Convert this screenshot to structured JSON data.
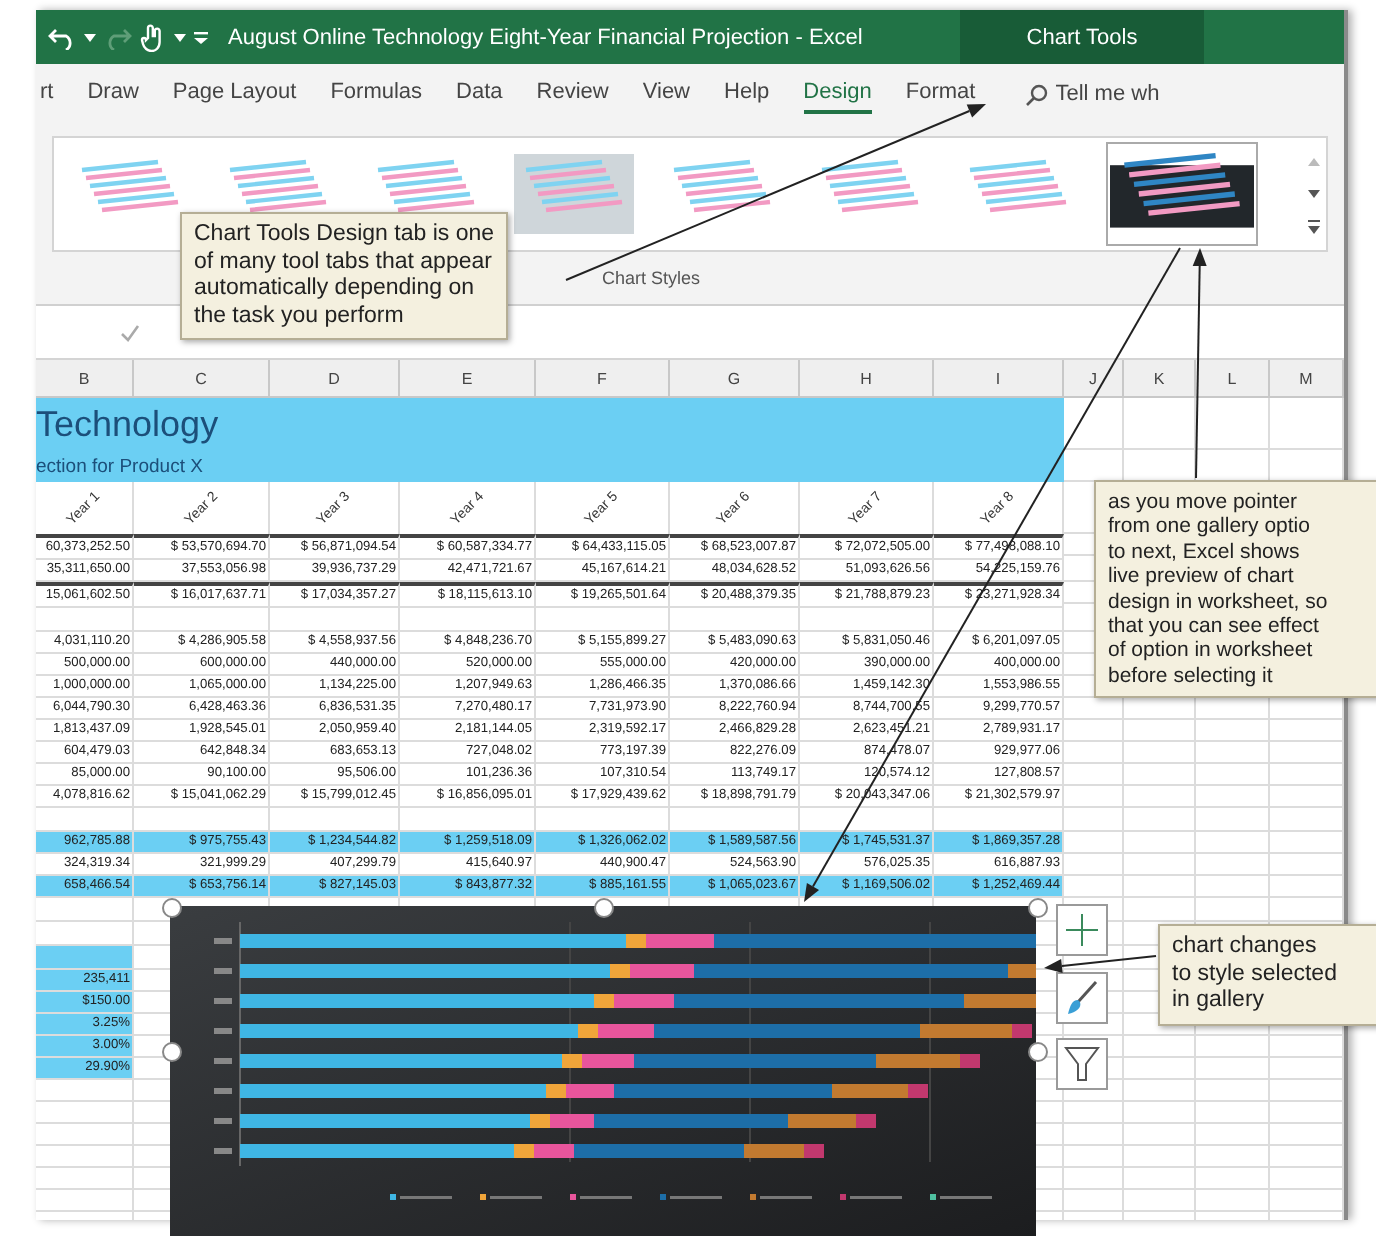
{
  "title_bar": {
    "title": "August Online Technology Eight-Year Financial Projection  -  Excel",
    "context_tab": "Chart Tools"
  },
  "ribbon": {
    "tabs": [
      {
        "label": "rt",
        "selected": false
      },
      {
        "label": "Draw",
        "selected": false
      },
      {
        "label": "Page Layout",
        "selected": false
      },
      {
        "label": "Formulas",
        "selected": false
      },
      {
        "label": "Data",
        "selected": false
      },
      {
        "label": "Review",
        "selected": false
      },
      {
        "label": "View",
        "selected": false
      },
      {
        "label": "Help",
        "selected": false
      },
      {
        "label": "Design",
        "selected": true
      },
      {
        "label": "Format",
        "selected": false
      }
    ],
    "search": {
      "placeholder": "Tell me wh"
    }
  },
  "gallery": {
    "label": "Chart Styles",
    "styles": [
      {
        "selected": false
      },
      {
        "selected": false
      },
      {
        "selected": false
      },
      {
        "selected": false
      },
      {
        "selected": false
      },
      {
        "selected": false
      },
      {
        "selected": false
      },
      {
        "selected": true
      }
    ]
  },
  "sheet": {
    "columns": [
      "B",
      "C",
      "D",
      "E",
      "F",
      "G",
      "H",
      "I",
      "J",
      "K",
      "L",
      "M"
    ],
    "title": "Technology",
    "subtitle": "ection for Product X",
    "year_headers": [
      "Year 1",
      "Year 2",
      "Year 3",
      "Year 4",
      "Year 5",
      "Year 6",
      "Year 7",
      "Year 8"
    ],
    "rows": [
      {
        "kind": "data",
        "highlighted": false,
        "top_rule": true,
        "cells": [
          "60,373,252.50",
          "$ 53,570,694.70",
          "$ 56,871,094.54",
          "$ 60,587,334.77",
          "$ 64,433,115.05",
          "$ 68,523,007.87",
          "$ 72,072,505.00",
          "$ 77,498,088.10"
        ]
      },
      {
        "kind": "data",
        "highlighted": false,
        "top_rule": false,
        "cells": [
          "35,311,650.00",
          "37,553,056.98",
          "39,936,737.29",
          "42,471,721.67",
          "45,167,614.21",
          "48,034,628.52",
          "51,093,626.56",
          "54,225,159.76"
        ]
      },
      {
        "kind": "data",
        "highlighted": false,
        "top_rule": true,
        "cells": [
          "15,061,602.50",
          "$ 16,017,637.71",
          "$ 17,034,357.27",
          "$ 18,115,613.10",
          "$ 19,265,501.64",
          "$ 20,488,379.35",
          "$ 21,788,879.23",
          "$ 23,271,928.34"
        ]
      },
      {
        "kind": "blank",
        "highlighted": false,
        "top_rule": false
      },
      {
        "kind": "data",
        "highlighted": false,
        "top_rule": false,
        "cells": [
          "4,031,110.20",
          "$ 4,286,905.58",
          "$ 4,558,937.56",
          "$ 4,848,236.70",
          "$ 5,155,899.27",
          "$ 5,483,090.63",
          "$ 5,831,050.46",
          "$ 6,201,097.05"
        ]
      },
      {
        "kind": "data",
        "highlighted": false,
        "top_rule": false,
        "cells": [
          "500,000.00",
          "600,000.00",
          "440,000.00",
          "520,000.00",
          "555,000.00",
          "420,000.00",
          "390,000.00",
          "400,000.00"
        ]
      },
      {
        "kind": "data",
        "highlighted": false,
        "top_rule": false,
        "cells": [
          "1,000,000.00",
          "1,065,000.00",
          "1,134,225.00",
          "1,207,949.63",
          "1,286,466.35",
          "1,370,086.66",
          "1,459,142.30",
          "1,553,986.55"
        ]
      },
      {
        "kind": "data",
        "highlighted": false,
        "top_rule": false,
        "cells": [
          "6,044,790.30",
          "6,428,463.36",
          "6,836,531.35",
          "7,270,480.17",
          "7,731,973.90",
          "8,222,760.94",
          "8,744,700.55",
          "9,299,770.57"
        ]
      },
      {
        "kind": "data",
        "highlighted": false,
        "top_rule": false,
        "cells": [
          "1,813,437.09",
          "1,928,545.01",
          "2,050,959.40",
          "2,181,144.05",
          "2,319,592.17",
          "2,466,829.28",
          "2,623,451.21",
          "2,789,931.17"
        ]
      },
      {
        "kind": "data",
        "highlighted": false,
        "top_rule": false,
        "cells": [
          "604,479.03",
          "642,848.34",
          "683,653.13",
          "727,048.02",
          "773,197.39",
          "822,276.09",
          "874,478.07",
          "929,977.06"
        ]
      },
      {
        "kind": "data",
        "highlighted": false,
        "top_rule": false,
        "cells": [
          "85,000.00",
          "90,100.00",
          "95,506.00",
          "101,236.36",
          "107,310.54",
          "113,749.17",
          "120,574.12",
          "127,808.57"
        ]
      },
      {
        "kind": "data",
        "highlighted": false,
        "top_rule": false,
        "cells": [
          "4,078,816.62",
          "$ 15,041,062.29",
          "$ 15,799,012.45",
          "$ 16,856,095.01",
          "$ 17,929,439.62",
          "$ 18,898,791.79",
          "$ 20,043,347.06",
          "$ 21,302,579.97"
        ]
      },
      {
        "kind": "blank",
        "highlighted": false,
        "top_rule": false
      },
      {
        "kind": "data",
        "highlighted": true,
        "top_rule": false,
        "cells": [
          "962,785.88",
          "$ 975,755.43",
          "$ 1,234,544.82",
          "$ 1,259,518.09",
          "$ 1,326,062.02",
          "$ 1,589,587.56",
          "$ 1,745,531.37",
          "$ 1,869,357.28"
        ]
      },
      {
        "kind": "data",
        "highlighted": false,
        "top_rule": false,
        "cells": [
          "324,319.34",
          "321,999.29",
          "407,299.79",
          "415,640.97",
          "440,900.47",
          "524,563.90",
          "576,025.35",
          "616,887.93"
        ]
      },
      {
        "kind": "data",
        "highlighted": true,
        "top_rule": false,
        "cells": [
          "658,466.54",
          "$ 653,756.14",
          "$ 827,145.03",
          "$ 843,877.32",
          "$ 885,161.55",
          "$ 1,065,023.67",
          "$ 1,169,506.02",
          "$ 1,252,469.44"
        ]
      },
      {
        "kind": "blank",
        "highlighted": false,
        "top_rule": false
      },
      {
        "kind": "blank",
        "highlighted": false,
        "top_rule": false
      },
      {
        "kind": "blank",
        "highlighted": true,
        "top_rule": false
      },
      {
        "kind": "input",
        "highlighted": true,
        "top_rule": false,
        "value": "235,411"
      },
      {
        "kind": "input",
        "highlighted": true,
        "top_rule": false,
        "value": "$150.00"
      },
      {
        "kind": "input",
        "highlighted": true,
        "top_rule": false,
        "value": "3.25%"
      },
      {
        "kind": "input",
        "highlighted": true,
        "top_rule": false,
        "value": "3.00%"
      },
      {
        "kind": "input",
        "highlighted": true,
        "top_rule": false,
        "value": "29.90%"
      }
    ]
  },
  "callouts": [
    {
      "text": "Chart Tools Design tab is one\nof many tool tabs that appear\nautomatically depending on\nthe task you perform"
    },
    {
      "text": "as you move pointer\nfrom one gallery optio\nto next, Excel shows\nlive preview of chart\ndesign in worksheet, so\nthat you can see effect\nof option in worksheet\nbefore selecting it"
    },
    {
      "text": "chart changes\nto style selected\nin gallery"
    }
  ]
}
